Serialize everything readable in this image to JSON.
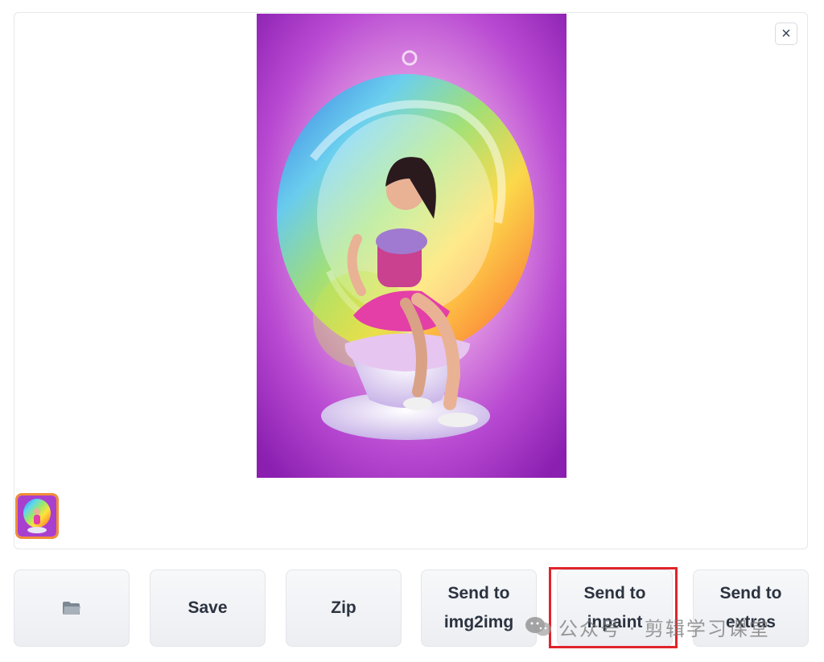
{
  "gallery": {
    "close_label": "×"
  },
  "buttons": {
    "open_folder_icon": "folder-icon",
    "save_label": "Save",
    "zip_label": "Zip",
    "send_img2img": [
      "Send to",
      "img2img"
    ],
    "send_inpaint": [
      "Send to",
      "inpaint"
    ],
    "send_extras": [
      "Send to",
      "extras"
    ]
  },
  "watermark": {
    "text": "公众号 · 剪辑学习课堂"
  },
  "colors": {
    "highlight": "#e0242b",
    "thumb_selected": "#f28c38"
  }
}
